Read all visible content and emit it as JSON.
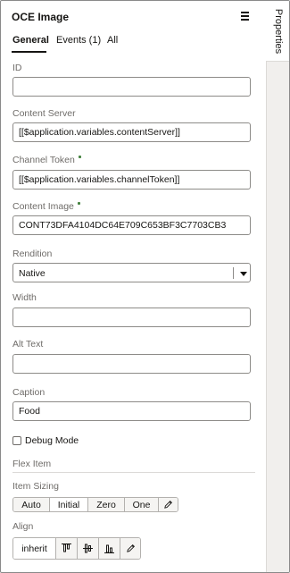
{
  "panel": {
    "title": "OCE Image",
    "menu_icon": "hamburger-menu-icon",
    "tabs": [
      {
        "label": "General",
        "active": true
      },
      {
        "label": "Events (1)",
        "active": false
      },
      {
        "label": "All",
        "active": false
      }
    ]
  },
  "rail": {
    "properties_label": "Properties"
  },
  "fields": {
    "id": {
      "label": "ID",
      "value": ""
    },
    "content_server": {
      "label": "Content Server",
      "value": "[[$application.variables.contentServer]]"
    },
    "channel_token": {
      "label": "Channel Token",
      "value": "[[$application.variables.channelToken]]",
      "required": true
    },
    "content_image": {
      "label": "Content Image",
      "value": "CONT73DFA4104DC64E709C653BF3C7703CB3",
      "required": true
    },
    "rendition": {
      "label": "Rendition",
      "value": "Native"
    },
    "width": {
      "label": "Width",
      "value": ""
    },
    "alt_text": {
      "label": "Alt Text",
      "value": ""
    },
    "caption": {
      "label": "Caption",
      "value": "Food"
    }
  },
  "debug_mode": {
    "label": "Debug Mode",
    "checked": false
  },
  "flex_item": {
    "section_title": "Flex Item",
    "item_sizing": {
      "label": "Item Sizing",
      "options": [
        "Auto",
        "Initial",
        "Zero",
        "One"
      ],
      "selected": "Initial",
      "edit_icon": "pencil-icon"
    },
    "align": {
      "label": "Align",
      "selected": "inherit",
      "icons": [
        "align-top-icon",
        "align-center-icon",
        "align-bottom-icon",
        "pencil-icon"
      ]
    }
  },
  "colors": {
    "required_marker": "#44823f",
    "label_text": "#6f6c69",
    "border": "#8d8b88",
    "rail_bg": "#f1efed"
  }
}
